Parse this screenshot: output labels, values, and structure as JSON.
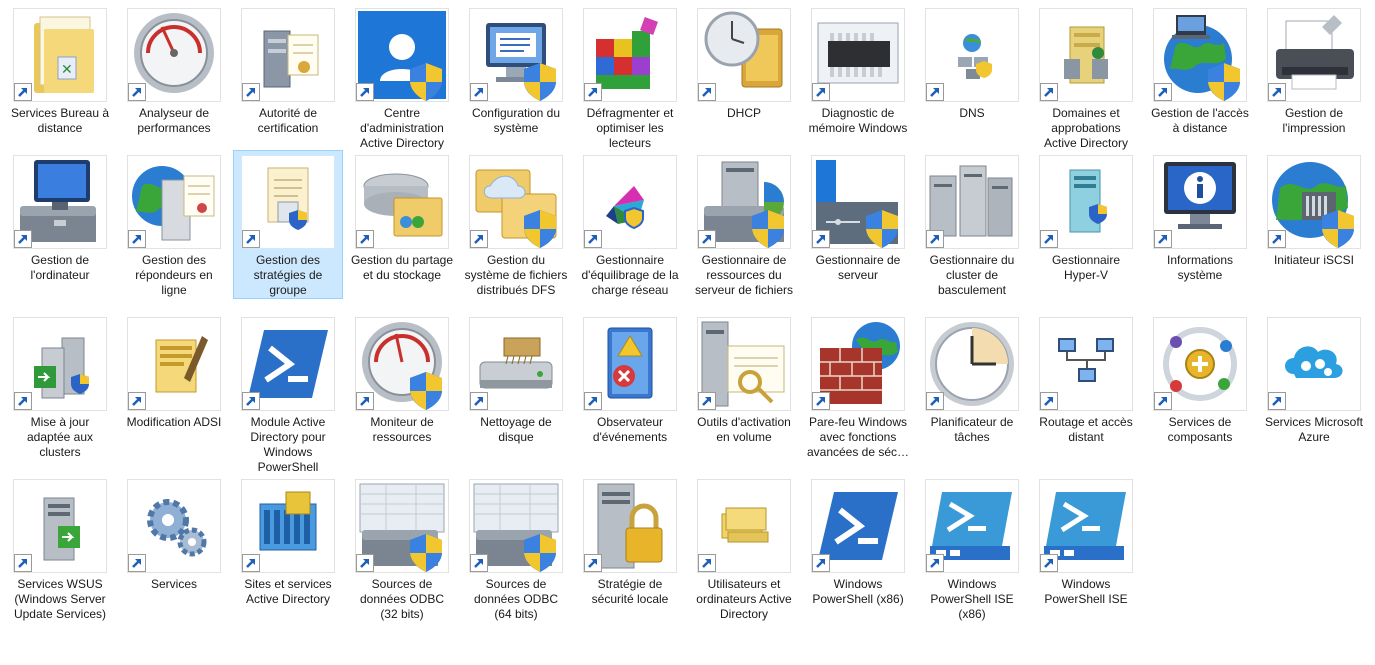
{
  "window": {
    "title": ""
  },
  "items": [
    {
      "label": "Services Bureau à distance",
      "icon": "folder-remote-desktop-icon"
    },
    {
      "label": "Analyseur de performances",
      "icon": "gauge-icon"
    },
    {
      "label": "Autorité de certification",
      "icon": "certificate-server-icon"
    },
    {
      "label": "Centre d'administration Active Directory",
      "icon": "ad-admin-center-icon"
    },
    {
      "label": "Configuration du système",
      "icon": "system-config-icon"
    },
    {
      "label": "Défragmenter et optimiser les lecteurs",
      "icon": "defragment-icon"
    },
    {
      "label": "DHCP",
      "icon": "dhcp-icon"
    },
    {
      "label": "Diagnostic de mémoire Windows",
      "icon": "memory-chip-icon"
    },
    {
      "label": "DNS",
      "icon": "dns-icon"
    },
    {
      "label": "Domaines et approbations Active Directory",
      "icon": "domains-trusts-icon"
    },
    {
      "label": "Gestion de l'accès à distance",
      "icon": "remote-access-globe-icon"
    },
    {
      "label": "Gestion de l'impression",
      "icon": "printer-icon"
    },
    {
      "label": "Gestion de l'ordinateur",
      "icon": "computer-management-icon"
    },
    {
      "label": "Gestion des répondeurs en ligne",
      "icon": "online-responder-icon"
    },
    {
      "label": "Gestion des stratégies de groupe",
      "icon": "group-policy-icon",
      "selected": true
    },
    {
      "label": "Gestion du partage et du stockage",
      "icon": "share-storage-icon"
    },
    {
      "label": "Gestion du système de fichiers distribués DFS",
      "icon": "dfs-icon"
    },
    {
      "label": "Gestionnaire d'équilibrage de la charge réseau",
      "icon": "nlb-icon"
    },
    {
      "label": "Gestionnaire de ressources du serveur de fichiers",
      "icon": "fsrm-icon"
    },
    {
      "label": "Gestionnaire de serveur",
      "icon": "server-manager-icon"
    },
    {
      "label": "Gestionnaire du cluster de basculement",
      "icon": "failover-cluster-icon"
    },
    {
      "label": "Gestionnaire Hyper-V",
      "icon": "hyper-v-icon"
    },
    {
      "label": "Informations système",
      "icon": "system-info-icon"
    },
    {
      "label": "Initiateur iSCSI",
      "icon": "iscsi-globe-icon"
    },
    {
      "label": "Mise à jour adaptée aux clusters",
      "icon": "cluster-update-icon"
    },
    {
      "label": "Modification ADSI",
      "icon": "adsi-edit-icon"
    },
    {
      "label": "Module Active Directory pour Windows PowerShell",
      "icon": "powershell-ad-icon"
    },
    {
      "label": "Moniteur de ressources",
      "icon": "resource-monitor-icon"
    },
    {
      "label": "Nettoyage de disque",
      "icon": "disk-cleanup-icon"
    },
    {
      "label": "Observateur d'événements",
      "icon": "event-viewer-icon"
    },
    {
      "label": "Outils d'activation en volume",
      "icon": "volume-activation-icon"
    },
    {
      "label": "Pare-feu Windows avec fonctions avancées de séc…",
      "icon": "firewall-icon"
    },
    {
      "label": "Planificateur de tâches",
      "icon": "task-scheduler-clock-icon"
    },
    {
      "label": "Routage et accès distant",
      "icon": "routing-icon"
    },
    {
      "label": "Services de composants",
      "icon": "component-services-icon"
    },
    {
      "label": "Services Microsoft Azure",
      "icon": "azure-cloud-icon"
    },
    {
      "label": "Services WSUS (Windows Server Update Services)",
      "icon": "wsus-icon"
    },
    {
      "label": "Services",
      "icon": "services-gears-icon"
    },
    {
      "label": "Sites et services Active Directory",
      "icon": "ad-sites-icon"
    },
    {
      "label": "Sources de données ODBC (32 bits)",
      "icon": "odbc-32-icon"
    },
    {
      "label": "Sources de données ODBC (64 bits)",
      "icon": "odbc-64-icon"
    },
    {
      "label": "Stratégie de sécurité locale",
      "icon": "local-security-lock-icon"
    },
    {
      "label": "Utilisateurs et ordinateurs Active Directory",
      "icon": "ad-users-computers-icon"
    },
    {
      "label": "Windows PowerShell (x86)",
      "icon": "powershell-x86-icon"
    },
    {
      "label": "Windows PowerShell ISE (x86)",
      "icon": "powershell-ise-x86-icon"
    },
    {
      "label": "Windows PowerShell ISE",
      "icon": "powershell-ise-icon"
    }
  ]
}
